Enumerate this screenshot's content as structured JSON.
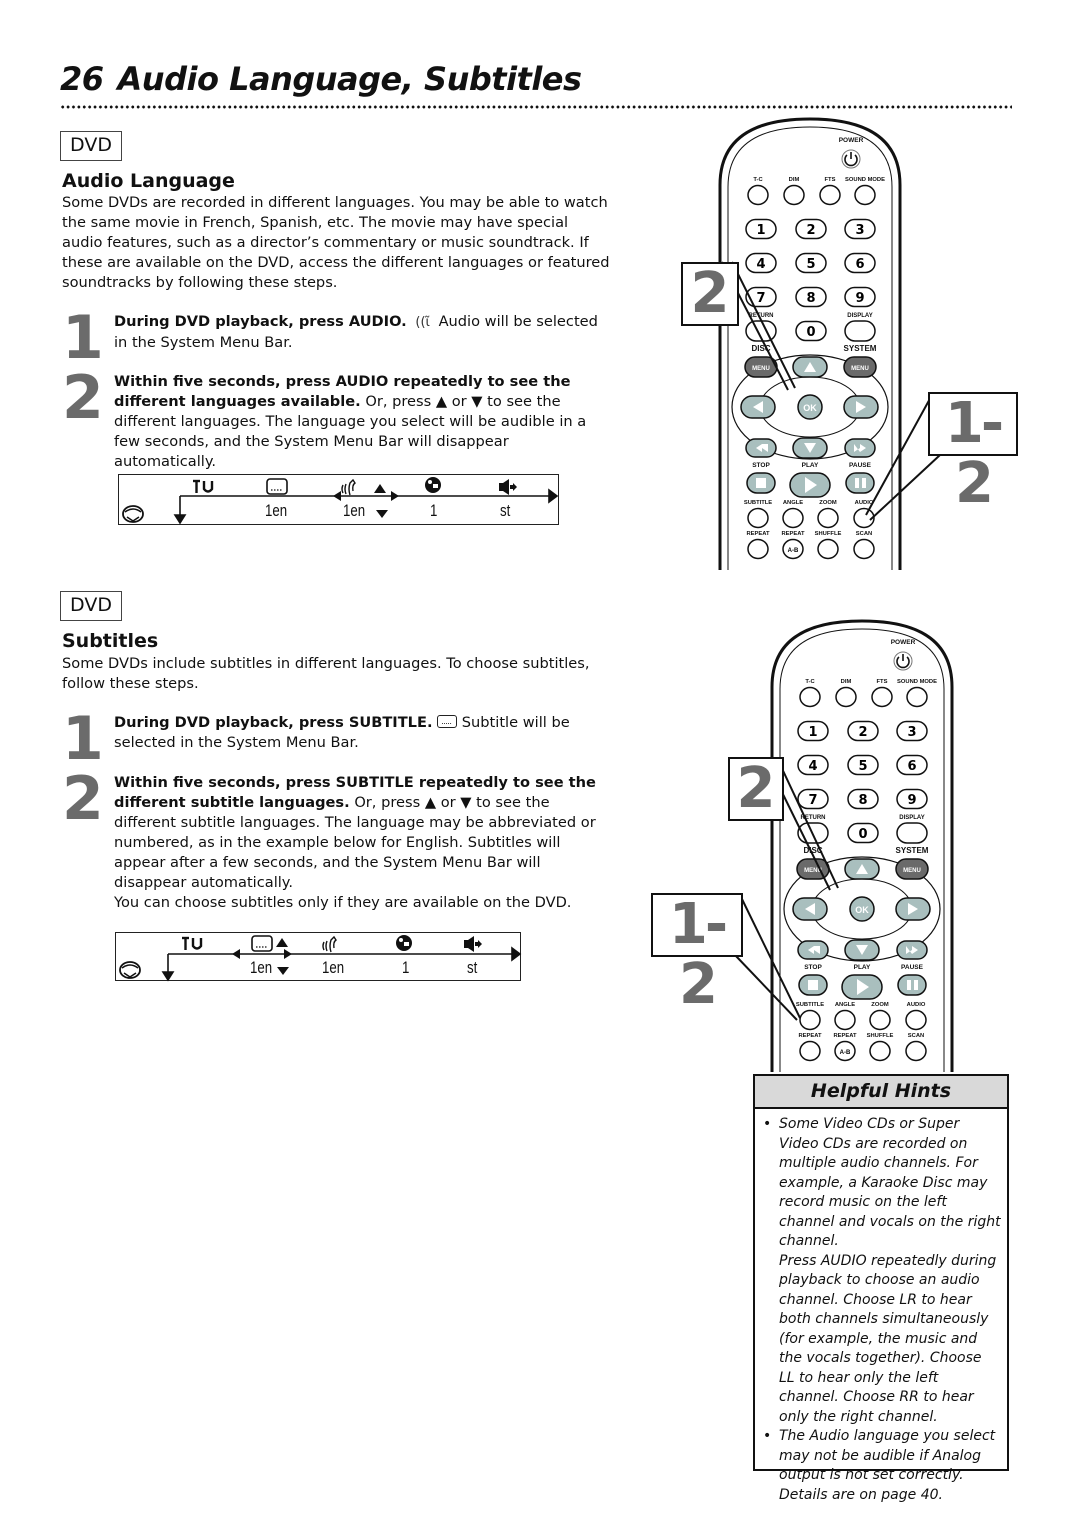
{
  "page": {
    "number": "26",
    "title": "Audio Language, Subtitles"
  },
  "audio_section": {
    "badge": "DVD",
    "heading": "Audio Language",
    "intro": "Some DVDs are recorded in different languages. You may be able to watch the same movie in French, Spanish, etc. The movie may have special audio features, such as a director’s commentary or music soundtrack. If these are available on the DVD, access the different languages or featured soundtracks by following these steps.",
    "steps": [
      {
        "number": "1",
        "bold": "During DVD playback, press AUDIO.",
        "icon": "audio-icon",
        "text": "Audio will be selected in the System Menu Bar."
      },
      {
        "number": "2",
        "bold": "Within five seconds, press AUDIO repeatedly to see the different languages available.",
        "text": "Or, press ▲ or ▼ to see the different languages. The language you select will be audible in a few seconds, and the System Menu Bar will disappear automatically."
      }
    ],
    "menu_bar": {
      "selected": "audio",
      "items": [
        {
          "icon": "settings-icon",
          "value": ""
        },
        {
          "icon": "subtitle-icon",
          "value": "1en"
        },
        {
          "icon": "audio-icon",
          "value": "1en"
        },
        {
          "icon": "angle-icon",
          "value": "1"
        },
        {
          "icon": "sound-icon",
          "value": "st"
        }
      ]
    }
  },
  "subtitle_section": {
    "badge": "DVD",
    "heading": "Subtitles",
    "intro": "Some DVDs include subtitles in different languages. To choose subtitles, follow these steps.",
    "steps": [
      {
        "number": "1",
        "bold": "During DVD playback, press SUBTITLE.",
        "icon": "subtitle-icon",
        "text": "Subtitle will be selected in the System Menu Bar."
      },
      {
        "number": "2",
        "bold": "Within five seconds, press SUBTITLE repeatedly to see the different subtitle languages.",
        "text": "Or, press ▲ or ▼ to see the different subtitle languages. The language may be abbreviated or numbered, as in the example below for English. Subtitles will appear after a few seconds, and the System Menu Bar will disappear automatically.",
        "note": "You can choose subtitles only if they are available on the DVD."
      }
    ],
    "menu_bar": {
      "selected": "subtitle",
      "items": [
        {
          "icon": "settings-icon",
          "value": ""
        },
        {
          "icon": "subtitle-icon",
          "value": "1en"
        },
        {
          "icon": "audio-icon",
          "value": "1en"
        },
        {
          "icon": "angle-icon",
          "value": "1"
        },
        {
          "icon": "sound-icon",
          "value": "st"
        }
      ]
    }
  },
  "remote": {
    "labels": {
      "power": "POWER",
      "tc": "T-C",
      "dim": "DIM",
      "fts": "FTS",
      "sound_mode": "SOUND MODE",
      "return": "RETURN",
      "display": "DISPLAY",
      "disc": "DISC",
      "system": "SYSTEM",
      "menu": "MENU",
      "ok": "OK",
      "stop": "STOP",
      "play": "PLAY",
      "pause": "PAUSE",
      "subtitle": "SUBTITLE",
      "angle": "ANGLE",
      "zoom": "ZOOM",
      "audio": "AUDIO",
      "repeat": "REPEAT",
      "repeat_ab": "REPEAT",
      "ab": "A-B",
      "shuffle": "SHUFFLE",
      "scan": "SCAN"
    },
    "digits": [
      "1",
      "2",
      "3",
      "4",
      "5",
      "6",
      "7",
      "8",
      "9",
      "0"
    ],
    "callouts_top": {
      "step2": "2",
      "step12": "1-2"
    },
    "callouts_bottom": {
      "step2": "2",
      "step12": "1-2"
    }
  },
  "hints": {
    "title": "Helpful Hints",
    "items": [
      {
        "text": "Some Video CDs or Super Video CDs are recorded on multiple audio channels. For example, a Karaoke Disc may record music on the left channel and vocals on the right channel.",
        "continuation": "Press AUDIO repeatedly during playback to choose an audio channel. Choose LR to hear both channels simultaneously (for example, the music and the vocals together). Choose LL to hear only the left channel. Choose RR to hear only the right channel."
      },
      {
        "text": "The Audio language you select may not be audible if Analog output is not set correctly. Details are on page 40."
      }
    ]
  },
  "colors": {
    "step_number": "#6b6b6b",
    "hints_header": "#d9d9d9",
    "nav_button": "#a9bfbe",
    "menu_button": "#6a6a6a"
  }
}
